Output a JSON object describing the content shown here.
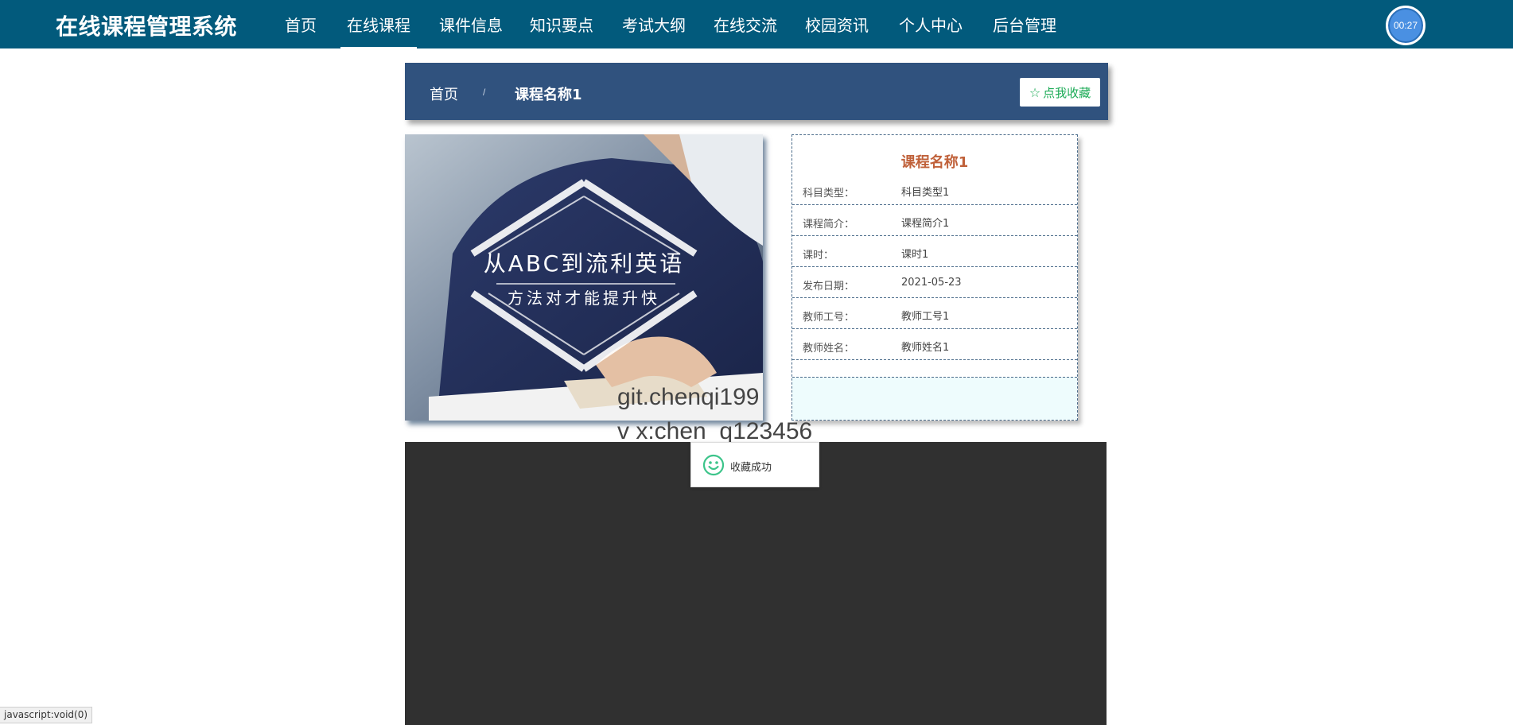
{
  "header": {
    "brand": "在线课程管理系统",
    "nav": [
      {
        "label": "首页",
        "active": false
      },
      {
        "label": "在线课程",
        "active": true
      },
      {
        "label": "课件信息",
        "active": false
      },
      {
        "label": "知识要点",
        "active": false
      },
      {
        "label": "考试大纲",
        "active": false
      },
      {
        "label": "在线交流",
        "active": false
      },
      {
        "label": "校园资讯",
        "active": false
      },
      {
        "label": "个人中心",
        "active": false
      },
      {
        "label": "后台管理",
        "active": false
      }
    ],
    "timer": "00:27"
  },
  "breadcrumb": {
    "home": "首页",
    "separator": "/",
    "current": "课程名称1"
  },
  "favorite_button": {
    "icon": "star-outline-icon",
    "label": "点我收藏"
  },
  "course_image": {
    "headline": "从ABC到流利英语",
    "subline": "方法对才能提升快"
  },
  "detail": {
    "title": "课程名称1",
    "rows": [
      {
        "key": "科目类型：",
        "value": "科目类型1"
      },
      {
        "key": "课程简介：",
        "value": "课程简介1"
      },
      {
        "key": "课时：",
        "value": "课时1"
      },
      {
        "key": "发布日期：",
        "value": "2021-05-23"
      },
      {
        "key": "教师工号：",
        "value": "教师工号1"
      },
      {
        "key": "教师姓名：",
        "value": "教师姓名1"
      }
    ]
  },
  "watermark": {
    "line1": "git.chenqi199",
    "line2": "v x:chen_q123456"
  },
  "toast": {
    "icon": "smile-icon",
    "message": "收藏成功"
  },
  "status_bar": "javascript:void(0)",
  "colors": {
    "topbar": "#025a7c",
    "breadcrumb_bar": "#30527e",
    "title_accent": "#c0613a",
    "favorite_green": "#1aaa55",
    "video_bg": "#303030"
  }
}
